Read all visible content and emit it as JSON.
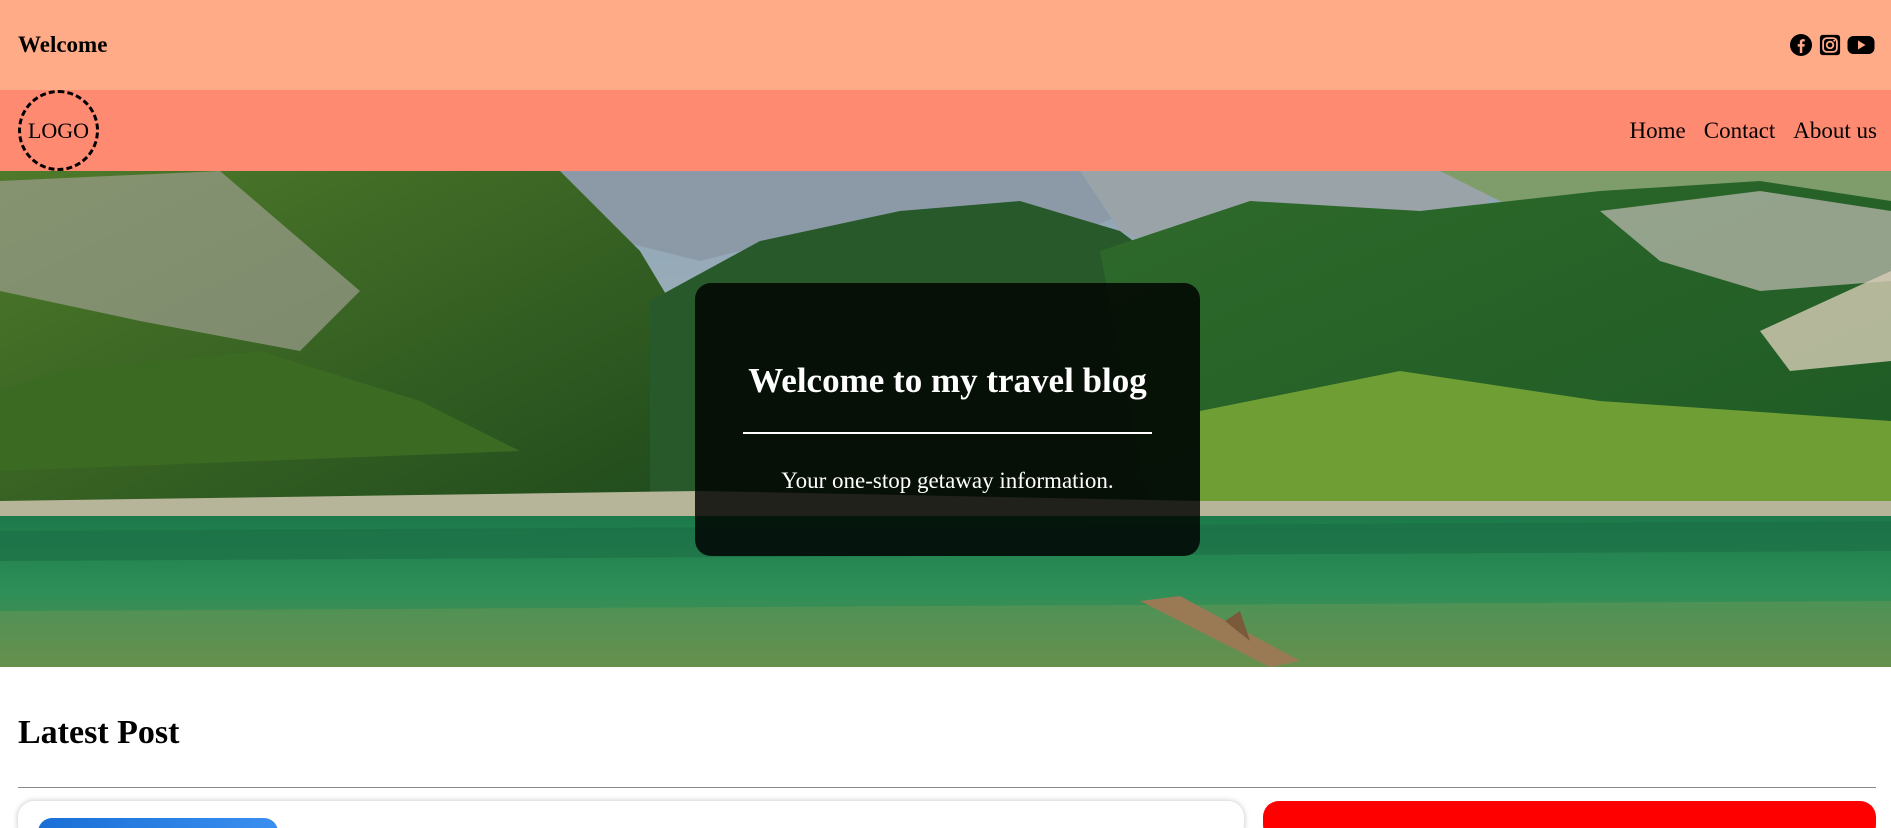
{
  "topbar": {
    "welcome": "Welcome",
    "social_icons": [
      "facebook-icon",
      "instagram-icon",
      "youtube-icon"
    ]
  },
  "navbar": {
    "logo": "LOGO",
    "links": [
      "Home",
      "Contact",
      "About us"
    ]
  },
  "hero": {
    "title": "Welcome to my travel blog",
    "subtitle": "Your one-stop getaway information."
  },
  "latest": {
    "title": "Latest Post"
  },
  "colors": {
    "topbar": "#ffab88",
    "navbar": "#ff8a72",
    "overlay": "#000000",
    "right_card": "#ff0000",
    "thumb": "#1a6fd6"
  }
}
